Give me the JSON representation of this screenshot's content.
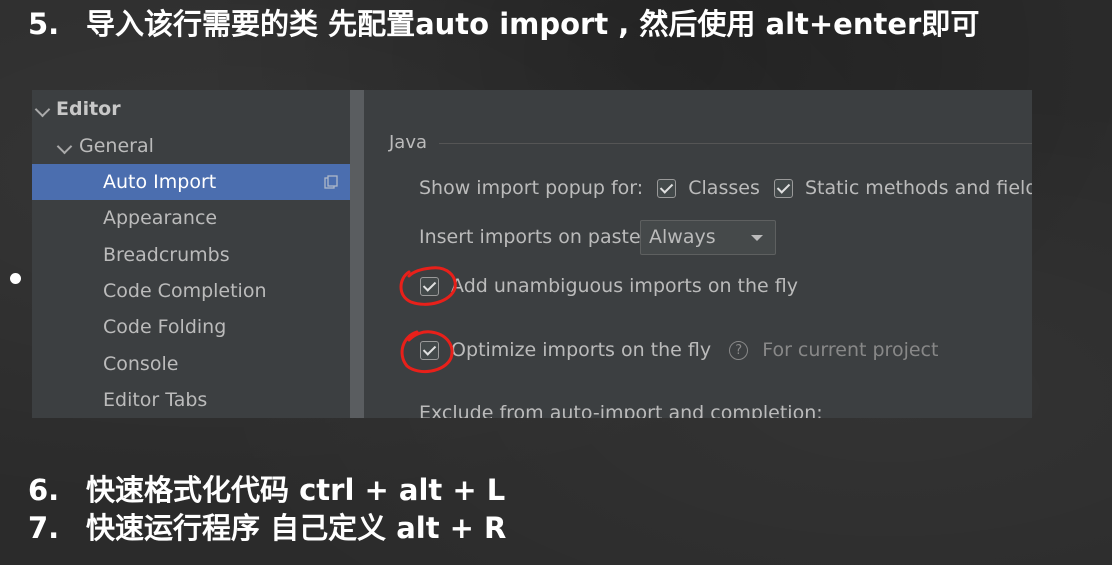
{
  "headings": {
    "h5": {
      "num": "5.",
      "text": "导入该行需要的类 先配置auto import , 然后使用 alt+enter即可"
    },
    "h6": {
      "num": "6.",
      "text": "快速格式化代码 ctrl + alt + L"
    },
    "h7": {
      "num": "7.",
      "text": "快速运行程序 自己定义 alt + R"
    }
  },
  "tree": {
    "editor": "Editor",
    "general": "General",
    "items": [
      "Auto Import",
      "Appearance",
      "Breadcrumbs",
      "Code Completion",
      "Code Folding",
      "Console",
      "Editor Tabs"
    ],
    "selected": "Auto Import"
  },
  "java": {
    "section_title": "Java",
    "popup_label": "Show import popup for:",
    "classes_label": "Classes",
    "static_label": "Static methods and fields",
    "insert_label": "Insert imports on paste:",
    "insert_value": "Always",
    "unambiguous_label": "Add unambiguous imports on the fly",
    "optimize_label": "Optimize imports on the fly",
    "scope_hint": "For current project",
    "exclude_label": "Exclude from auto-import and completion:"
  },
  "colors": {
    "selection": "#4b6eaf",
    "annotation": "#e8201a",
    "panel": "#3c3f41"
  },
  "icons": [
    "chevron-down-icon",
    "copy-icon",
    "checkbox-icon",
    "dropdown-arrow-icon",
    "help-icon"
  ]
}
